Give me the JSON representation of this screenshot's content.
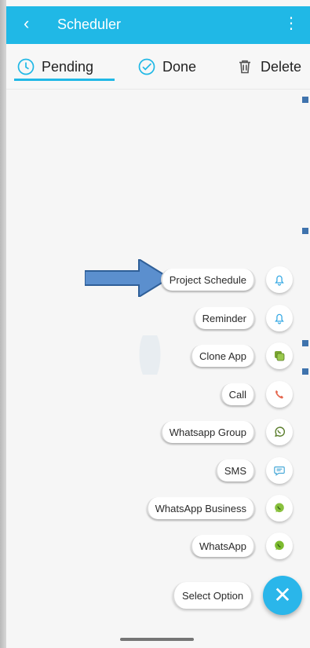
{
  "appbar": {
    "title": "Scheduler",
    "back_icon": "back-chevron-icon",
    "more_icon": "kebab-menu-icon"
  },
  "tabs": [
    {
      "label": "Pending",
      "icon": "clock-icon",
      "selected": true
    },
    {
      "label": "Done",
      "icon": "check-circle-icon",
      "selected": false
    },
    {
      "label": "Delete",
      "icon": "trash-icon",
      "selected": false
    }
  ],
  "options": [
    {
      "label": "Project Schedule",
      "icon": "bell-icon"
    },
    {
      "label": "Reminder",
      "icon": "bell-icon"
    },
    {
      "label": "Clone App",
      "icon": "clone-app-icon"
    },
    {
      "label": "Call",
      "icon": "phone-icon"
    },
    {
      "label": "Whatsapp Group",
      "icon": "whatsapp-icon"
    },
    {
      "label": "SMS",
      "icon": "sms-icon"
    },
    {
      "label": "WhatsApp Business",
      "icon": "whatsapp-business-icon"
    },
    {
      "label": "WhatsApp",
      "icon": "whatsapp-icon"
    }
  ],
  "footer": {
    "select_option": "Select Option",
    "fab_icon": "close-icon"
  },
  "colors": {
    "appbar": "#20b8e6",
    "accent": "#2ab6ea",
    "arrow": "#5b8fce"
  }
}
